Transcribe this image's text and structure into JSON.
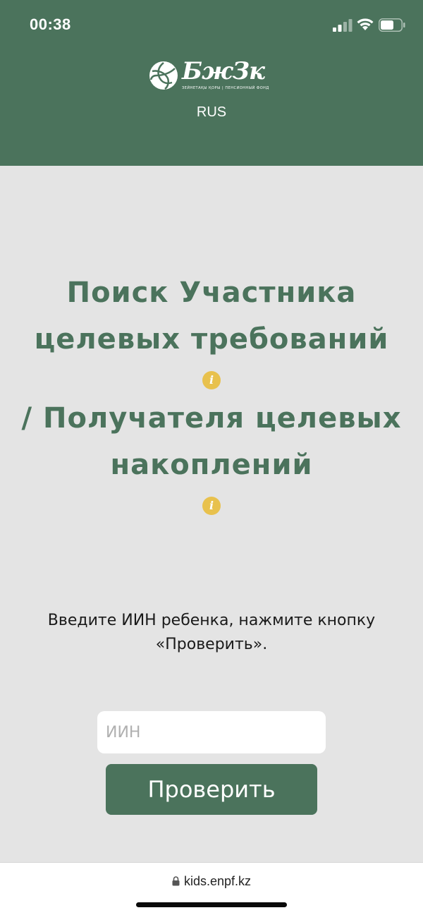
{
  "status_bar": {
    "time": "00:38",
    "icons": [
      "signal-icon",
      "wifi-icon",
      "battery-icon"
    ]
  },
  "header": {
    "logo_text": "БжЗк",
    "logo_tagline": "ЗЕЙНЕТАҚЫ ҚОРЫ | ПЕНСИОННЫЙ ФОНД",
    "language": "RUS",
    "background_color": "#4b735c"
  },
  "main": {
    "title_part1": "Поиск Участника целевых требований",
    "title_part2": "/ Получателя целевых накоплений",
    "info_icon": "info-icon",
    "instruction": "Введите ИИН ребенка, нажмите кнопку «Проверить».",
    "iin_input": {
      "placeholder": "ИИН",
      "value": ""
    },
    "check_button_label": "Проверить",
    "accent_color": "#4b735c",
    "info_color": "#e8c14d"
  },
  "browser": {
    "url": "kids.enpf.kz"
  }
}
